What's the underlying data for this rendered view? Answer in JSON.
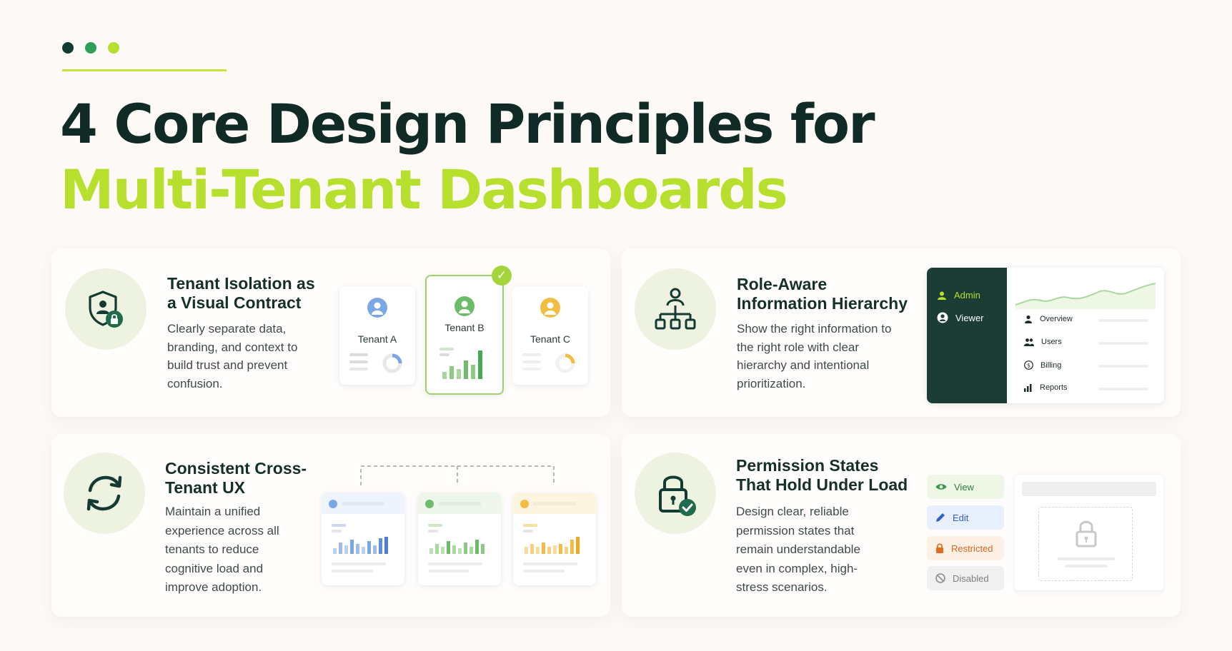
{
  "header": {
    "dot_colors": [
      "#123b33",
      "#2f9e57",
      "#b7df2e"
    ],
    "title_line1": "4 Core Design Principles for",
    "title_line2": "Multi-Tenant Dashboards"
  },
  "cards": [
    {
      "title": "Tenant Isolation as a Visual Contract",
      "body": "Clearly separate data, branding, and context to build trust and prevent confusion.",
      "icon": "shield-lock-icon",
      "tenants": [
        {
          "name": "Tenant A",
          "color": "#7aa7e8"
        },
        {
          "name": "Tenant B",
          "color": "#6cbc6a"
        },
        {
          "name": "Tenant C",
          "color": "#f3bd45"
        }
      ]
    },
    {
      "title": "Role-Aware Information Hierarchy",
      "body": "Show the right information to the right role with clear hierarchy and intentional prioritization.",
      "icon": "hierarchy-icon",
      "roles": [
        "Admin",
        "Viewer"
      ],
      "menu": [
        "Overview",
        "Users",
        "Billing",
        "Reports"
      ]
    },
    {
      "title": "Consistent Cross-Tenant UX",
      "body": "Maintain a unified experience across all tenants to reduce cognitive load and improve adoption.",
      "icon": "sync-icon"
    },
    {
      "title": "Permission States That Hold Under Load",
      "body": "Design clear, reliable permission states that remain understandable even in complex, high-stress scenarios.",
      "icon": "lock-check-icon",
      "states": [
        "View",
        "Edit",
        "Restricted",
        "Disabled"
      ]
    }
  ]
}
